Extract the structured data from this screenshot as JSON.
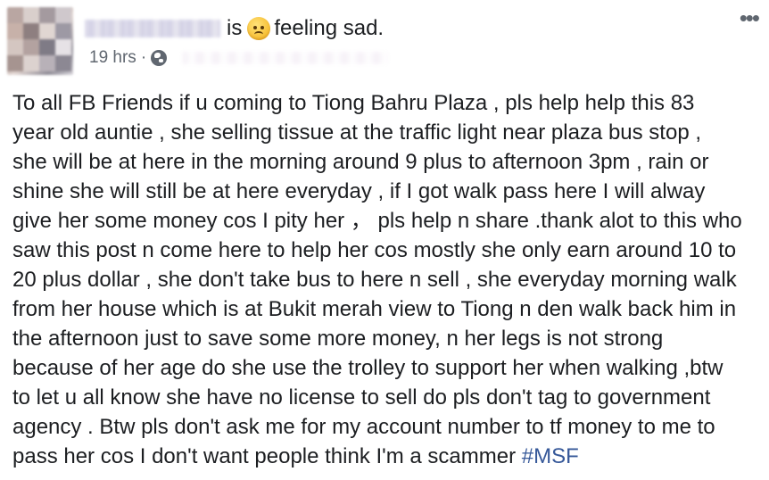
{
  "header": {
    "status_verb": "is",
    "feeling_text": "feeling sad.",
    "emoji_icon": "sad-face-emoji-icon",
    "more_label": "•••"
  },
  "meta": {
    "time": "19 hrs",
    "separator": "·",
    "privacy_icon": "globe-icon"
  },
  "post": {
    "lines": [
      "To all FB Friends if u coming to Tiong Bahru Plaza , pls help help this 83",
      "year old auntie , she selling tissue at the traffic light near plaza bus stop ,",
      "she will be at here in the morning around 9 plus to afternoon 3pm , rain or",
      "shine she will still be at here everyday , if I got walk pass here I will alway",
      "give her some money cos I pity her ，  pls help n share .thank alot to this who",
      "saw this post n come here to help her cos mostly she only earn around 10 to",
      "20 plus dollar , she don't take bus to here n sell , she everyday morning walk",
      "from her house which is at Bukit merah view to Tiong n den walk back him in",
      "the afternoon just to save some more money, n her legs is not strong",
      "because of her age do she use the trolley to support her when walking ,btw",
      "to let u all know she have no license to sell do pls don't tag to government",
      "agency . Btw pls don't ask me for my account number to tf money to me to"
    ],
    "last_line_text": "pass her cos I don't want people think I'm a scammer ",
    "hashtag": "#MSF"
  },
  "colors": {
    "text": "#1c1e21",
    "meta": "#606770",
    "link": "#365899"
  }
}
